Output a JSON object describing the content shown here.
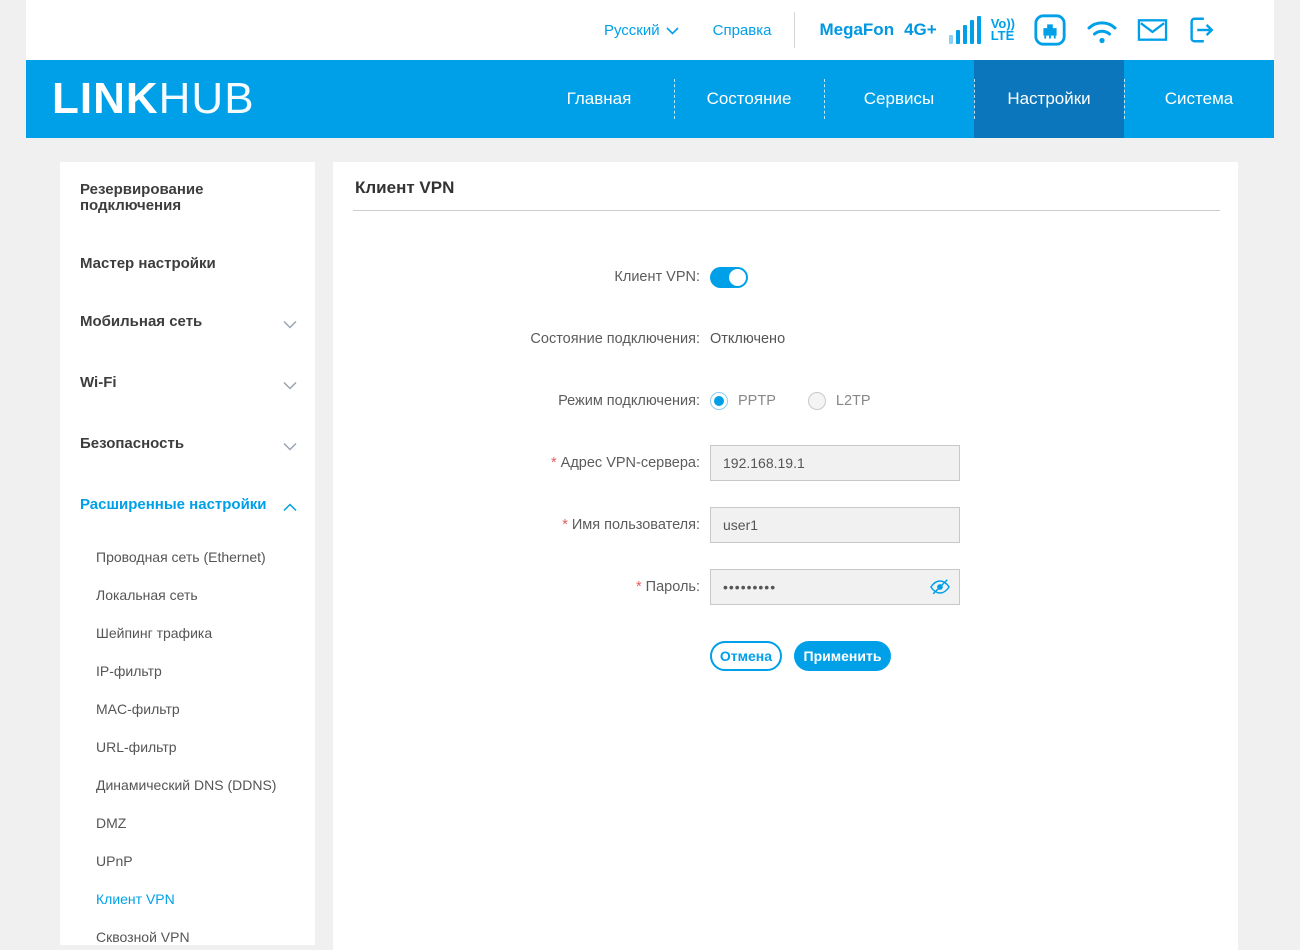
{
  "colors": {
    "accent": "#00a0e9",
    "navbar": "#00a0e9",
    "active_tab": "#0b76bb",
    "required_marker": "#e25d5d"
  },
  "topbar": {
    "language": "Русский",
    "help": "Справка",
    "operator": "MegaFon",
    "network": "4G+",
    "volte_line1": "Vo))",
    "volte_line2": "LTE",
    "icons": [
      "chevron-down-icon",
      "signal-bars-icon",
      "volte-icon",
      "ethernet-icon",
      "wifi-icon",
      "mail-icon",
      "logout-icon"
    ]
  },
  "navbar": {
    "logo_bold": "LINK",
    "logo_light": "HUB",
    "tabs": [
      {
        "label": "Главная",
        "active": false
      },
      {
        "label": "Состояние",
        "active": false
      },
      {
        "label": "Сервисы",
        "active": false
      },
      {
        "label": "Настройки",
        "active": true
      },
      {
        "label": "Система",
        "active": false
      }
    ]
  },
  "sidebar": {
    "items": [
      {
        "label": "Резервирование подключения"
      },
      {
        "label": "Мастер настройки"
      },
      {
        "label": "Мобильная сеть",
        "chevron": "down"
      },
      {
        "label": "Wi-Fi",
        "chevron": "down"
      },
      {
        "label": "Безопасность",
        "chevron": "down"
      },
      {
        "label": "Расширенные настройки",
        "chevron": "up",
        "expanded": true
      }
    ],
    "subitems": [
      {
        "label": "Проводная сеть (Ethernet)",
        "active": false
      },
      {
        "label": "Локальная сеть",
        "active": false
      },
      {
        "label": "Шейпинг трафика",
        "active": false
      },
      {
        "label": "IP-фильтр",
        "active": false
      },
      {
        "label": "MAC-фильтр",
        "active": false
      },
      {
        "label": "URL-фильтр",
        "active": false
      },
      {
        "label": "Динамический DNS (DDNS)",
        "active": false
      },
      {
        "label": "DMZ",
        "active": false
      },
      {
        "label": "UPnP",
        "active": false
      },
      {
        "label": "Клиент VPN",
        "active": true
      },
      {
        "label": "Сквозной VPN",
        "active": false
      }
    ]
  },
  "main": {
    "title": "Клиент VPN",
    "form": {
      "required_marker": "*",
      "toggle_label": "Клиент VPN:",
      "toggle_state": "on",
      "status_label": "Состояние подключения:",
      "status_value": "Отключено",
      "mode_label": "Режим подключения:",
      "mode_options": [
        {
          "label": "PPTP",
          "selected": true
        },
        {
          "label": "L2TP",
          "selected": false
        }
      ],
      "server_label": "Адрес VPN-сервера:",
      "server_value": "192.168.19.1",
      "user_label": "Имя пользователя:",
      "user_value": "user1",
      "password_label": "Пароль:",
      "password_value": "•••••••••",
      "password_eye_icon": "eye-slash-icon",
      "cancel_button": "Отмена",
      "apply_button": "Применить"
    }
  }
}
